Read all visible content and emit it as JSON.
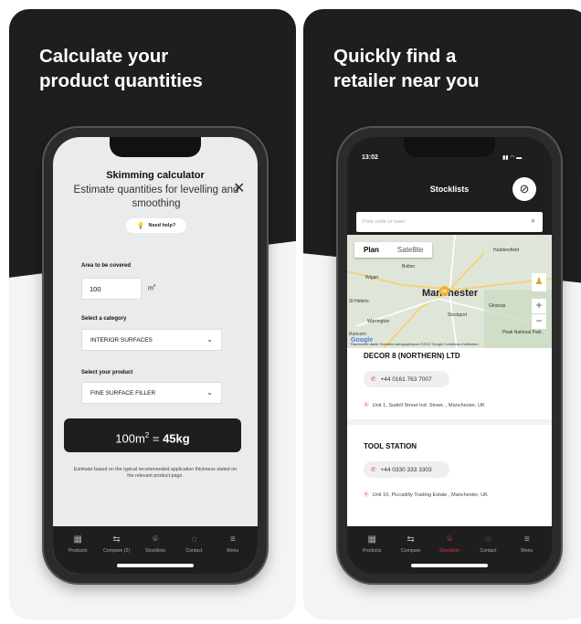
{
  "left_panel": {
    "headline": "Calculate your\nproduct quantities",
    "screen": {
      "title": "Skimming calculator",
      "subtitle": "Estimate quantities for levelling and smoothing",
      "help_label": "Need help?",
      "area_label": "Area to be covered",
      "area_value": "100",
      "area_unit": "m",
      "area_unit_power": "2",
      "category_label": "Select a category",
      "category_value": "INTERIOR SURFACES",
      "product_label": "Select your product",
      "product_value": "FINE SURFACE FILLER",
      "result_qty": "100m",
      "result_power": "2",
      "result_eq": " = ",
      "result_weight": "45kg",
      "note": "Estimate based on the typical recommended application thickness stated on the relevant product page.",
      "tabs": [
        {
          "label": "Products",
          "icon": "grid-icon"
        },
        {
          "label": "Compare (2)",
          "icon": "compare-icon"
        },
        {
          "label": "Stocklists",
          "icon": "pin-icon"
        },
        {
          "label": "Contact",
          "icon": "chat-icon"
        },
        {
          "label": "Menu",
          "icon": "menu-icon"
        }
      ]
    }
  },
  "right_panel": {
    "headline": "Quickly find a\nretailer near you",
    "screen": {
      "time": "13:02",
      "title": "Stocklists",
      "search_placeholder": "Post code or town",
      "map": {
        "tabs": [
          "Plan",
          "Satellite"
        ],
        "labels": [
          "Bolton",
          "Wigan",
          "St Helens",
          "Warrington",
          "Stockport",
          "Huddersfield",
          "Glossop",
          "Runcorn",
          "Peak National Park"
        ],
        "city": "Manchester",
        "cluster_count": "26",
        "footer": "Raccourcis clavier   Données cartographiques ©2022 Google   Conditions d'utilisation",
        "google_label": "Google"
      },
      "stores": [
        {
          "name": "DECOR 8 (NORTHERN) LTD",
          "phone": "+44 0161 763 7007",
          "address": "Unit 1, Sudell Street Ind. Street. , Manchester, UK"
        },
        {
          "name": "TOOL STATION",
          "phone": "+44 0330 333 3303",
          "address": "Unit 10, Piccadilly Trading Estate , Manchester, UK"
        }
      ],
      "tabs": [
        {
          "label": "Products",
          "icon": "grid-icon"
        },
        {
          "label": "Compare",
          "icon": "compare-icon"
        },
        {
          "label": "Stocklists",
          "icon": "pin-icon"
        },
        {
          "label": "Contact",
          "icon": "chat-icon"
        },
        {
          "label": "Menu",
          "icon": "menu-icon"
        }
      ],
      "active_tab": "Stocklists"
    }
  },
  "colors": {
    "dark": "#1e1e1e",
    "accent": "#e23b3b",
    "light": "#ebebeb"
  }
}
